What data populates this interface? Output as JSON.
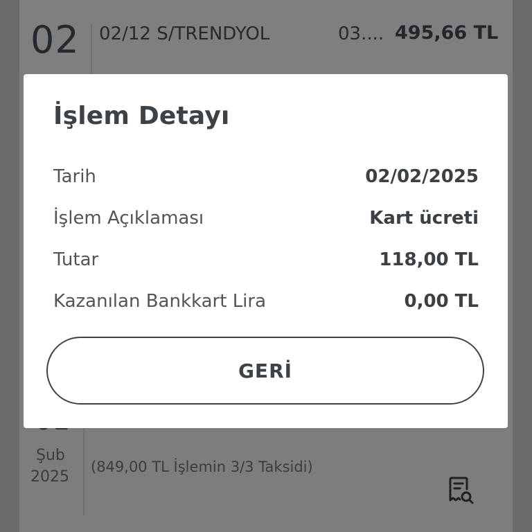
{
  "background_list": {
    "top_row": {
      "day": "02",
      "description": "02/12 S/TRENDYOL",
      "date_truncated": "03....",
      "amount": "495,66 TL"
    },
    "bottom_row": {
      "month": "Şub",
      "year": "2025",
      "note": "(849,00 TL İşlemin 3/3  Taksidi)",
      "icon": "receipt-search-icon"
    }
  },
  "modal": {
    "title": "İşlem Detayı",
    "rows": [
      {
        "label": "Tarih",
        "value": "02/02/2025"
      },
      {
        "label": "İşlem Açıklaması",
        "value": "Kart ücreti"
      },
      {
        "label": "Tutar",
        "value": "118,00 TL"
      },
      {
        "label": "Kazanılan Bankkart Lira",
        "value": "0,00 TL"
      }
    ],
    "back_button_label": "GERİ"
  },
  "colors": {
    "overlay": "#7d7d7d",
    "modal_bg": "#ffffff",
    "text_primary": "#3d4247"
  }
}
